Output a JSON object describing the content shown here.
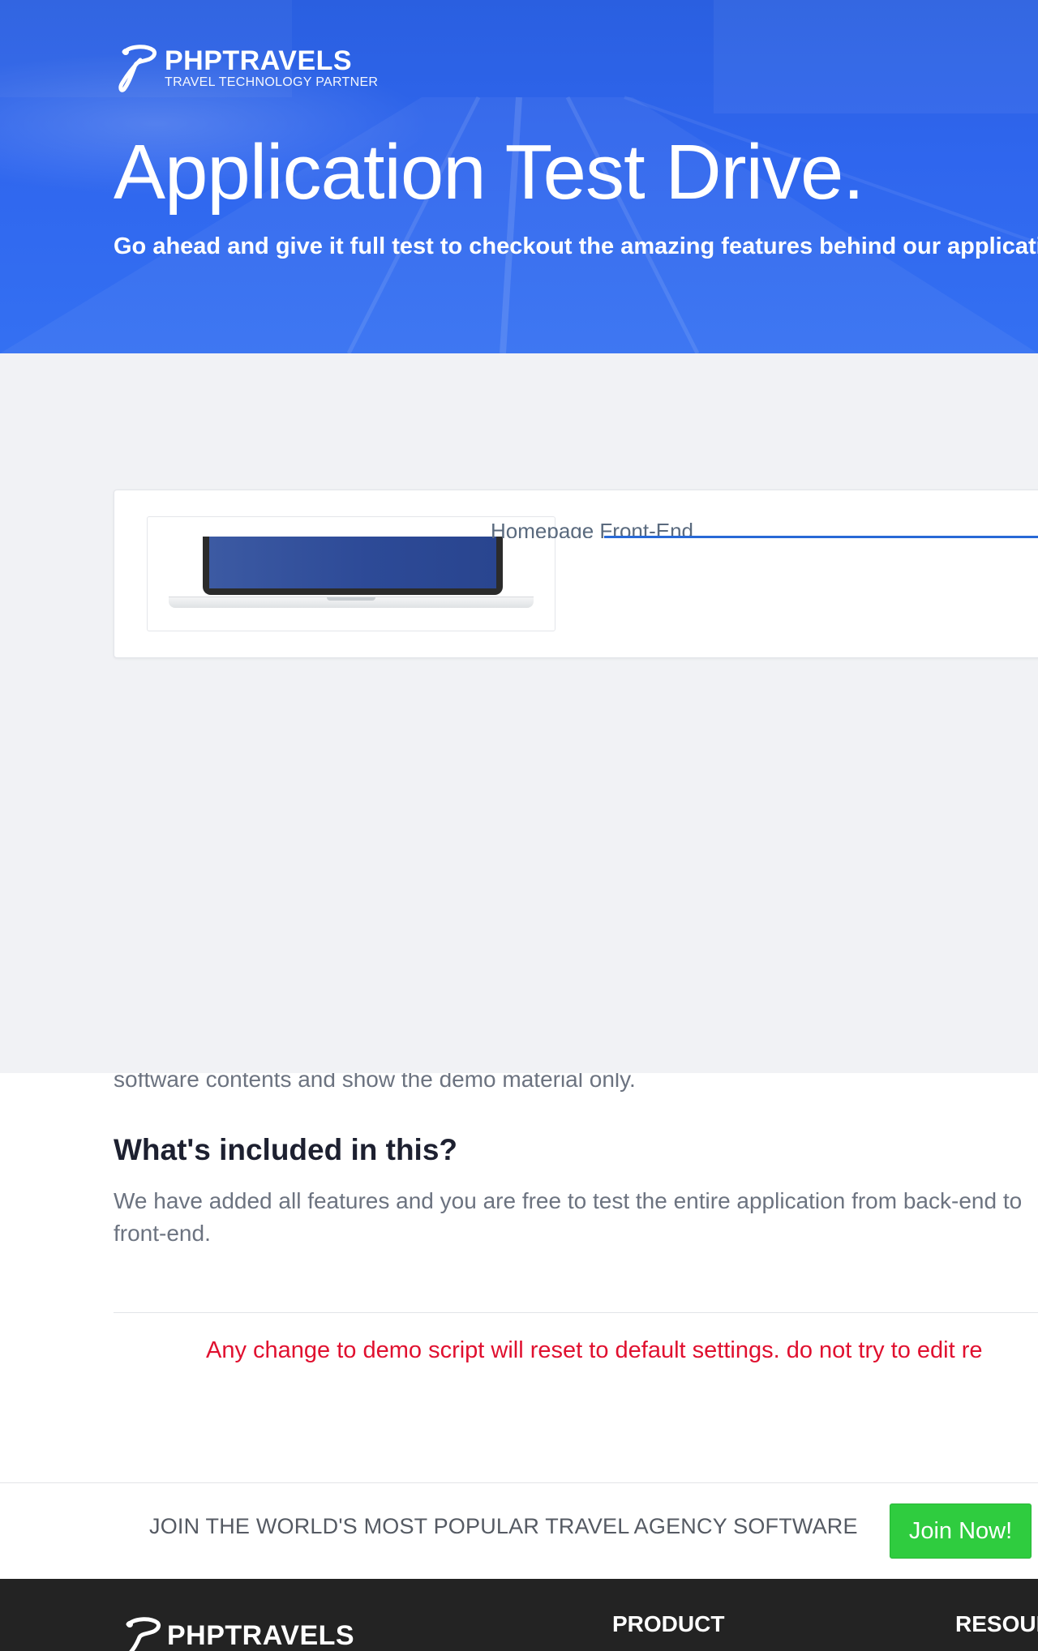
{
  "brand": {
    "name": "PHPTRAVELS",
    "tagline": "TRAVEL TECHNOLOGY PARTNER"
  },
  "hero": {
    "title": "Application Test Drive.",
    "subtitle": "Go ahead and give it full test to checkout the amazing features behind our applicatio"
  },
  "demo_card": {
    "link_label": "Homepage Front-End"
  },
  "content": {
    "cut_paragraph": "software contents and show the demo material only.",
    "included_heading": "What's included in this?",
    "included_text": "We have added all features and you are free to test the entire application from back-end to front-end.",
    "warning": "Any change to demo script will reset to default settings. do not try to edit re"
  },
  "join": {
    "text": "JOIN THE WORLD'S MOST POPULAR TRAVEL AGENCY SOFTWARE",
    "button": "Join Now!"
  },
  "footer": {
    "brand": "PHPTRAVELS",
    "columns": [
      "PRODUCT",
      "RESOUR"
    ]
  },
  "colors": {
    "hero_blue": "#2f66ee",
    "warning_red": "#e0102f",
    "join_green": "#2fcc3f",
    "link_bar_blue": "#2869d6",
    "footer_bg": "#232323"
  }
}
